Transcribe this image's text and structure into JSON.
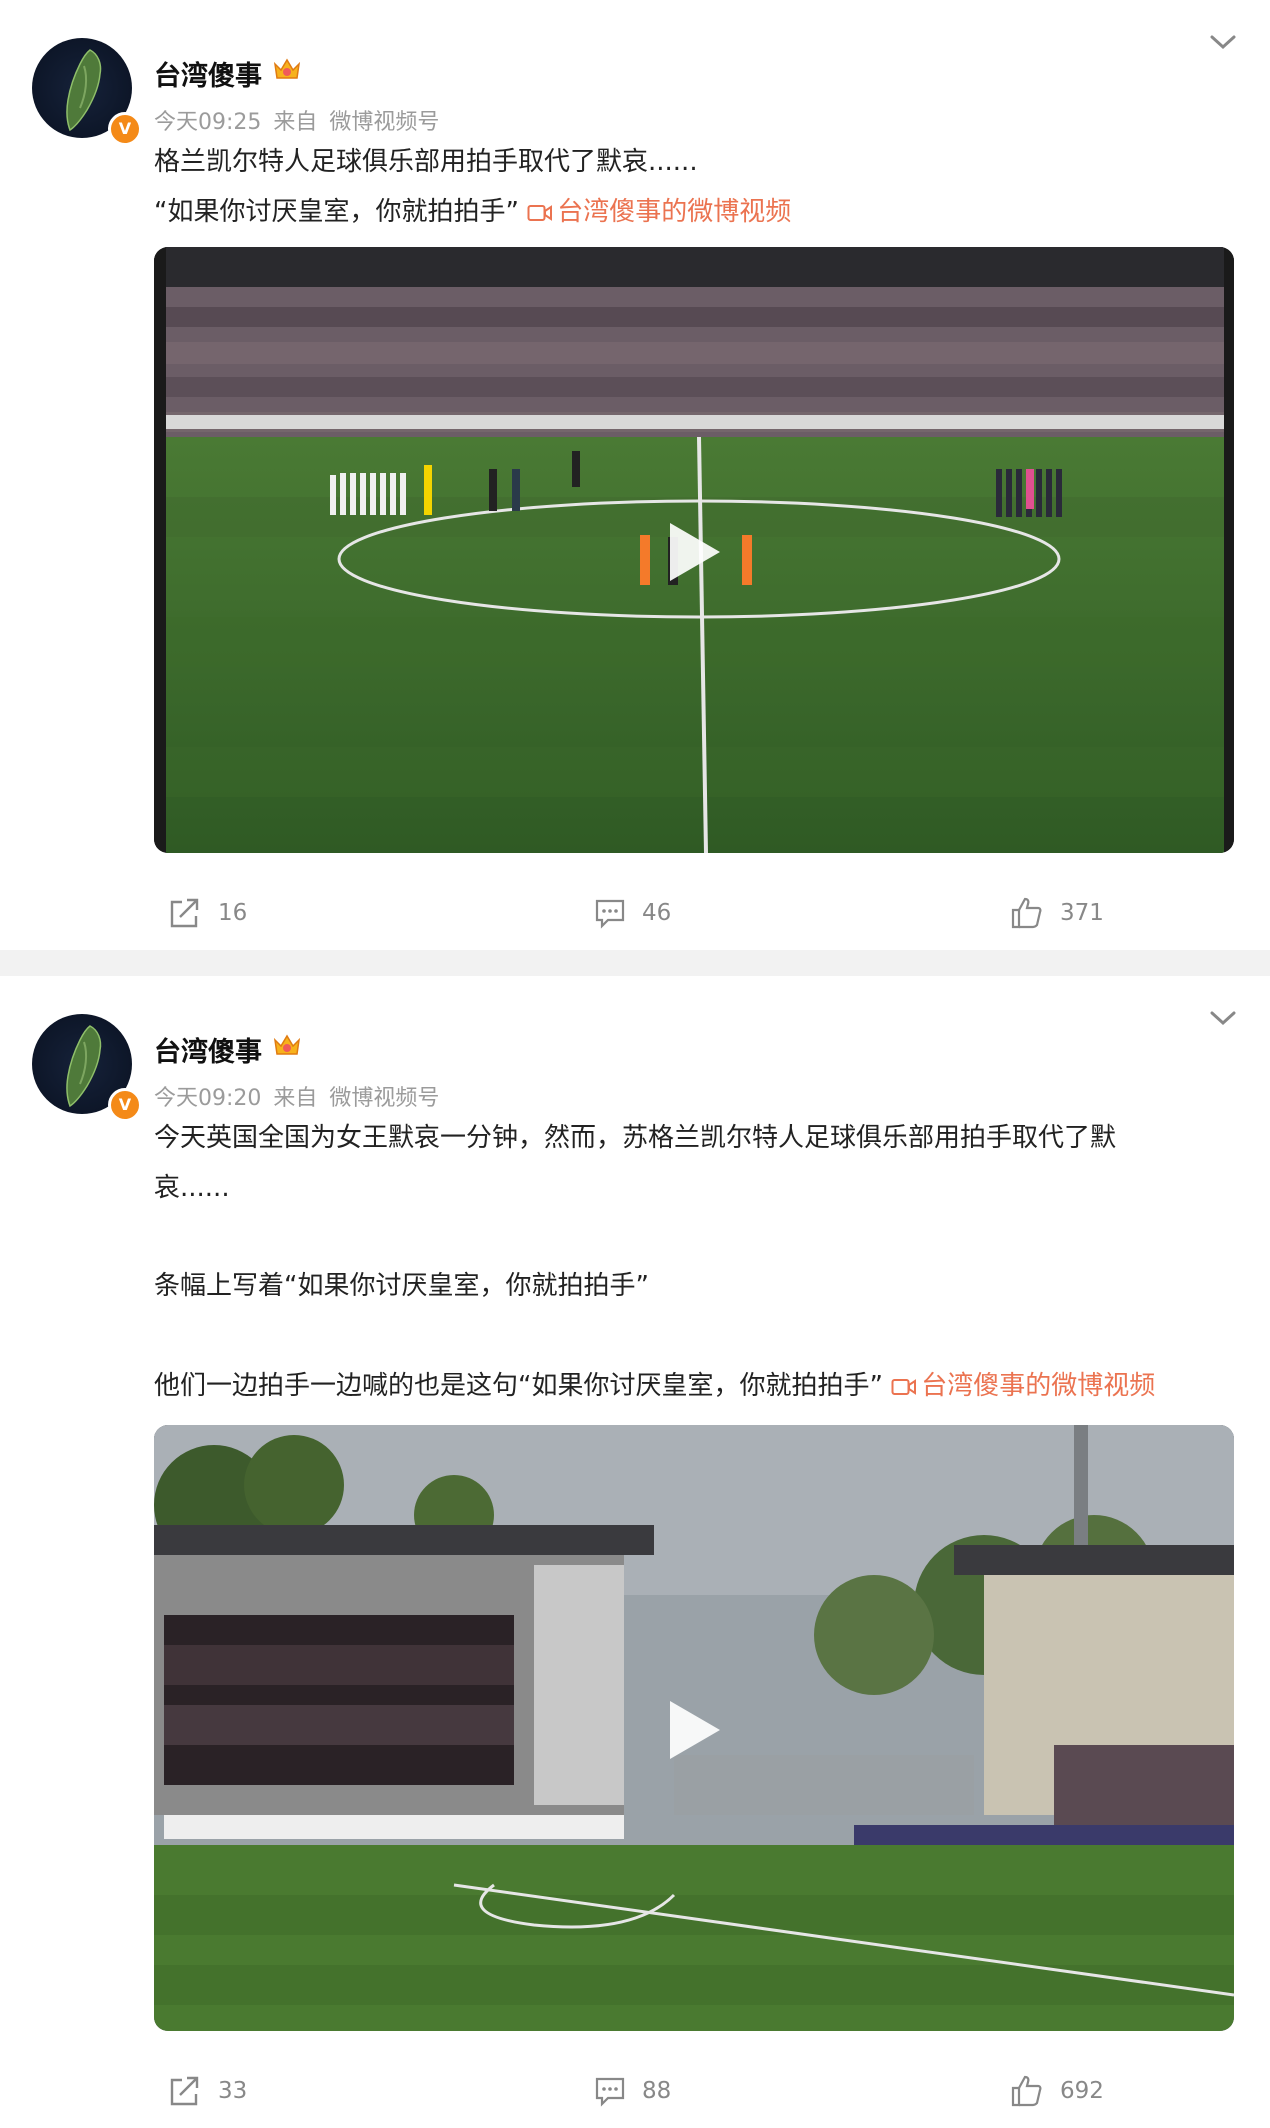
{
  "posts": [
    {
      "user": {
        "name": "台湾傻事",
        "verified": true,
        "badge_color": "#f48a18"
      },
      "time": "今天09:25",
      "source_prefix": "来自",
      "source": "微博视频号",
      "text_lines": [
        "格兰凯尔特人足球俱乐部用拍手取代了默哀......",
        "“如果你讨厌皇室，你就拍拍手”"
      ],
      "video_link": "台湾傻事的微博视频",
      "video": {
        "description": "football-pitch-players-lined-up"
      },
      "actions": {
        "repost": "16",
        "comment": "46",
        "like": "371"
      }
    },
    {
      "user": {
        "name": "台湾傻事",
        "verified": true,
        "badge_color": "#f48a18"
      },
      "time": "今天09:20",
      "source_prefix": "来自",
      "source": "微博视频号",
      "text_lines": [
        "今天英国全国为女王默哀一分钟，然而，苏格兰凯尔特人足球俱乐部用拍手取代了默",
        "哀......",
        "",
        "条幅上写着“如果你讨厌皇室，你就拍拍手”",
        "",
        "他们一边拍手一边喊的也是这句“如果你讨厌皇室，你就拍拍手”"
      ],
      "video_link": "台湾傻事的微博视频",
      "video": {
        "description": "stadium-stand-view"
      },
      "actions": {
        "repost": "33",
        "comment": "88",
        "like": "692"
      }
    }
  ],
  "colors": {
    "link": "#eb7350",
    "meta": "#9b9b9b",
    "pitch": "#3f6a2e",
    "divider": "#f2f2f2"
  }
}
